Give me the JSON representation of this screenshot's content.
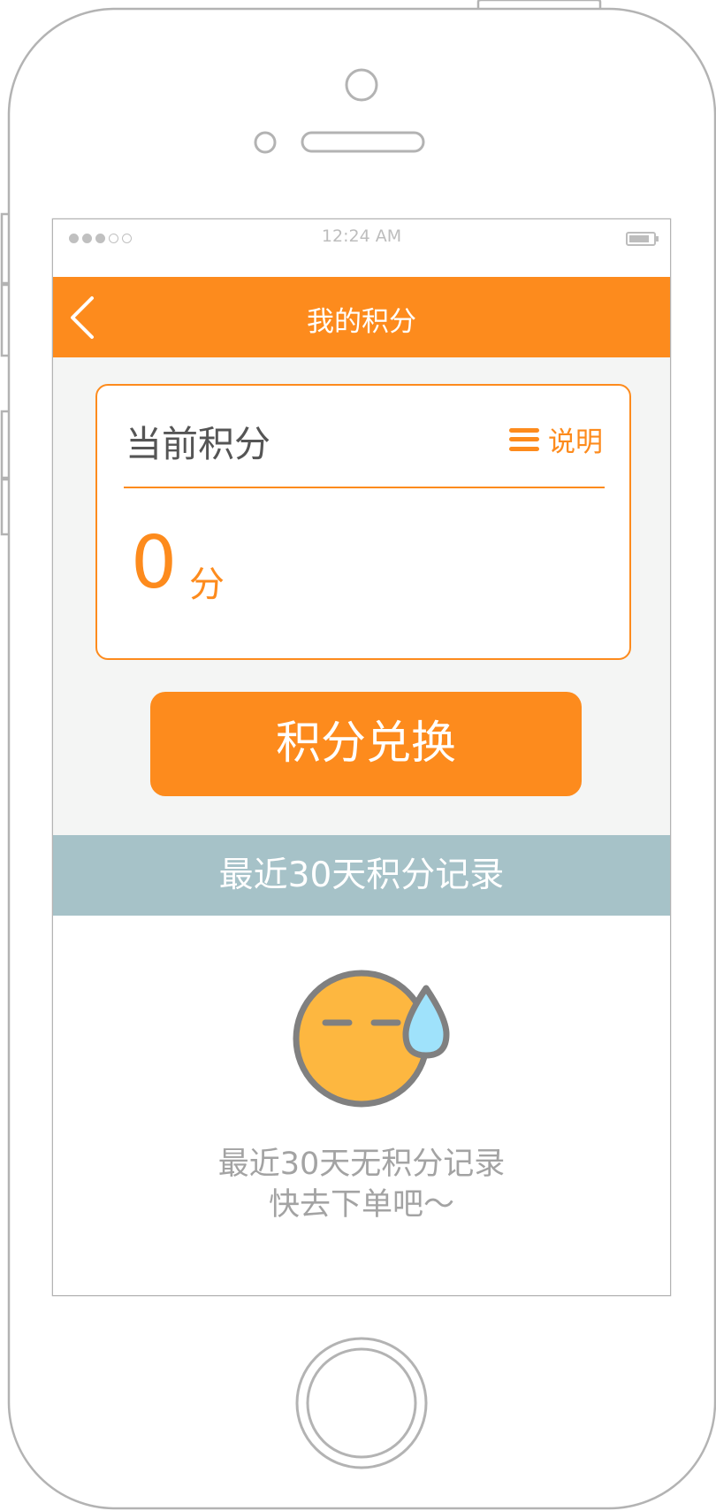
{
  "status_bar": {
    "time": "12:24 AM",
    "signal_bars_filled": 3,
    "signal_bars_total": 5
  },
  "nav": {
    "title": "我的积分",
    "back_icon": "chevron-left-icon"
  },
  "points_card": {
    "title": "当前积分",
    "explain_label": "说明",
    "explain_icon": "menu-icon",
    "value": "0",
    "unit": "分"
  },
  "exchange_button": {
    "label": "积分兑换"
  },
  "records": {
    "header": "最近30天积分记录",
    "empty_icon": "sweat-face-icon",
    "empty_line1": "最近30天无积分记录",
    "empty_line2": "快去下单吧～"
  },
  "colors": {
    "accent": "#fd8b1d",
    "section_header": "#a6c2c8",
    "background": "#f4f5f4",
    "emoji_face": "#fdb740",
    "emoji_drop": "#9fe2fb"
  }
}
